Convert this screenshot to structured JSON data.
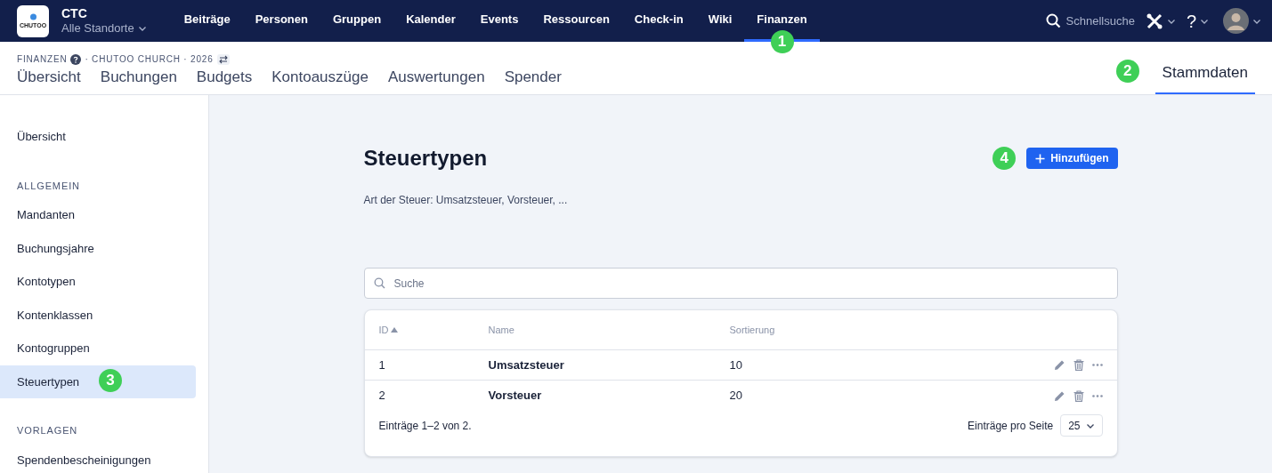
{
  "topbar": {
    "logo_text": "CHUTOO",
    "org": "CTC",
    "location": "Alle Standorte",
    "nav": [
      {
        "label": "Beiträge",
        "selected": false
      },
      {
        "label": "Personen",
        "selected": false
      },
      {
        "label": "Gruppen",
        "selected": false
      },
      {
        "label": "Kalender",
        "selected": false
      },
      {
        "label": "Events",
        "selected": false
      },
      {
        "label": "Ressourcen",
        "selected": false
      },
      {
        "label": "Check-in",
        "selected": false
      },
      {
        "label": "Wiki",
        "selected": false
      },
      {
        "label": "Finanzen",
        "selected": true,
        "badge": "1"
      }
    ],
    "search_label": "Schnellsuche",
    "help": "?"
  },
  "subheader": {
    "breadcrumb": [
      "FINANZEN",
      "· CHUTOO CHURCH · 2026"
    ],
    "tabs": [
      {
        "label": "Übersicht",
        "selected": false
      },
      {
        "label": "Buchungen",
        "selected": false
      },
      {
        "label": "Budgets",
        "selected": false
      },
      {
        "label": "Kontoauszüge",
        "selected": false
      },
      {
        "label": "Auswertungen",
        "selected": false
      },
      {
        "label": "Spender",
        "selected": false
      }
    ],
    "right_tab": {
      "label": "Stammdaten",
      "selected": true,
      "badge": "2"
    }
  },
  "sidebar": {
    "items": [
      {
        "kind": "item",
        "label": "Übersicht",
        "selected": false
      },
      {
        "kind": "heading",
        "label": "ALLGEMEIN"
      },
      {
        "kind": "item",
        "label": "Mandanten",
        "selected": false
      },
      {
        "kind": "item",
        "label": "Buchungsjahre",
        "selected": false
      },
      {
        "kind": "item",
        "label": "Kontotypen",
        "selected": false
      },
      {
        "kind": "item",
        "label": "Kontenklassen",
        "selected": false
      },
      {
        "kind": "item",
        "label": "Kontogruppen",
        "selected": false
      },
      {
        "kind": "item",
        "label": "Steuertypen",
        "selected": true,
        "badge": "3"
      },
      {
        "kind": "heading",
        "label": "VORLAGEN"
      },
      {
        "kind": "item",
        "label": "Spendenbescheinigungen",
        "selected": false
      }
    ]
  },
  "page": {
    "title": "Steuertypen",
    "description": "Art der Steuer: Umsatzsteuer, Vorsteuer, ...",
    "add_button": {
      "label": "Hinzufügen",
      "badge": "4"
    },
    "search": {
      "placeholder": "Suche"
    },
    "table": {
      "columns": [
        {
          "label": "ID",
          "sorted": true
        },
        {
          "label": "Name",
          "sorted": false
        },
        {
          "label": "Sortierung",
          "sorted": false
        }
      ],
      "rows": [
        {
          "id": "1",
          "name": "Umsatzsteuer",
          "sort": "10"
        },
        {
          "id": "2",
          "name": "Vorsteuer",
          "sort": "20"
        }
      ],
      "summary": "Einträge 1–2 von 2.",
      "per_page_label": "Einträge pro Seite",
      "per_page": "25"
    }
  }
}
